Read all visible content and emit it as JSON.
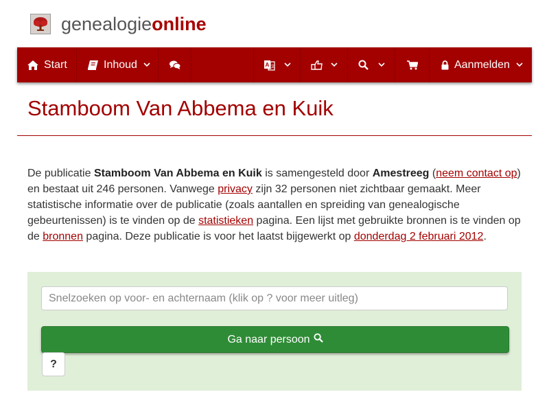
{
  "site": {
    "brand_part1": "genealogie",
    "brand_part2": "online",
    "brand_color": "#a80000"
  },
  "nav": {
    "items": [
      {
        "label": "Start",
        "icon": "home-icon"
      },
      {
        "label": "Inhoud",
        "icon": "book-icon",
        "dropdown": true
      },
      {
        "label": "",
        "icon": "comments-icon"
      },
      {
        "label": "",
        "icon": "language-icon",
        "dropdown": true
      },
      {
        "label": "",
        "icon": "share-icon",
        "dropdown": true
      },
      {
        "label": "",
        "icon": "search-icon",
        "dropdown": true
      },
      {
        "label": "",
        "icon": "cart-icon"
      },
      {
        "label": "Aanmelden",
        "icon": "lock-icon",
        "dropdown": true
      }
    ],
    "background": "#a30000"
  },
  "page": {
    "title": "Stamboom Van Abbema en Kuik"
  },
  "intro": {
    "t1": "De publicatie ",
    "publication": "Stamboom Van Abbema en Kuik",
    "t2": " is samengesteld door ",
    "author": "Amestreeg",
    "t3": " (",
    "contact_link": "neem contact op",
    "t4": ") en bestaat uit 246 personen. Vanwege ",
    "privacy_link": "privacy",
    "t5": " zijn 32 personen niet zichtbaar gemaakt. Meer statistische informatie over de publicatie (zoals aantallen en spreiding van genealogische gebeurtenissen) is te vinden op de ",
    "stats_link": "statistieken",
    "t6": " pagina. Een lijst met gebruikte bronnen is te vinden op de ",
    "sources_link": "bronnen",
    "t7": " pagina. Deze publicatie is voor het laatst bijgewerkt op ",
    "date_link": "donderdag 2 februari 2012",
    "t8": "."
  },
  "search": {
    "placeholder": "Snelzoeken op voor- en achternaam (klik op ? voor meer uitleg)",
    "value": "",
    "go_label": "Ga naar persoon",
    "help_label": "?",
    "panel_color": "#e0efd8",
    "button_color": "#2f8c36"
  }
}
